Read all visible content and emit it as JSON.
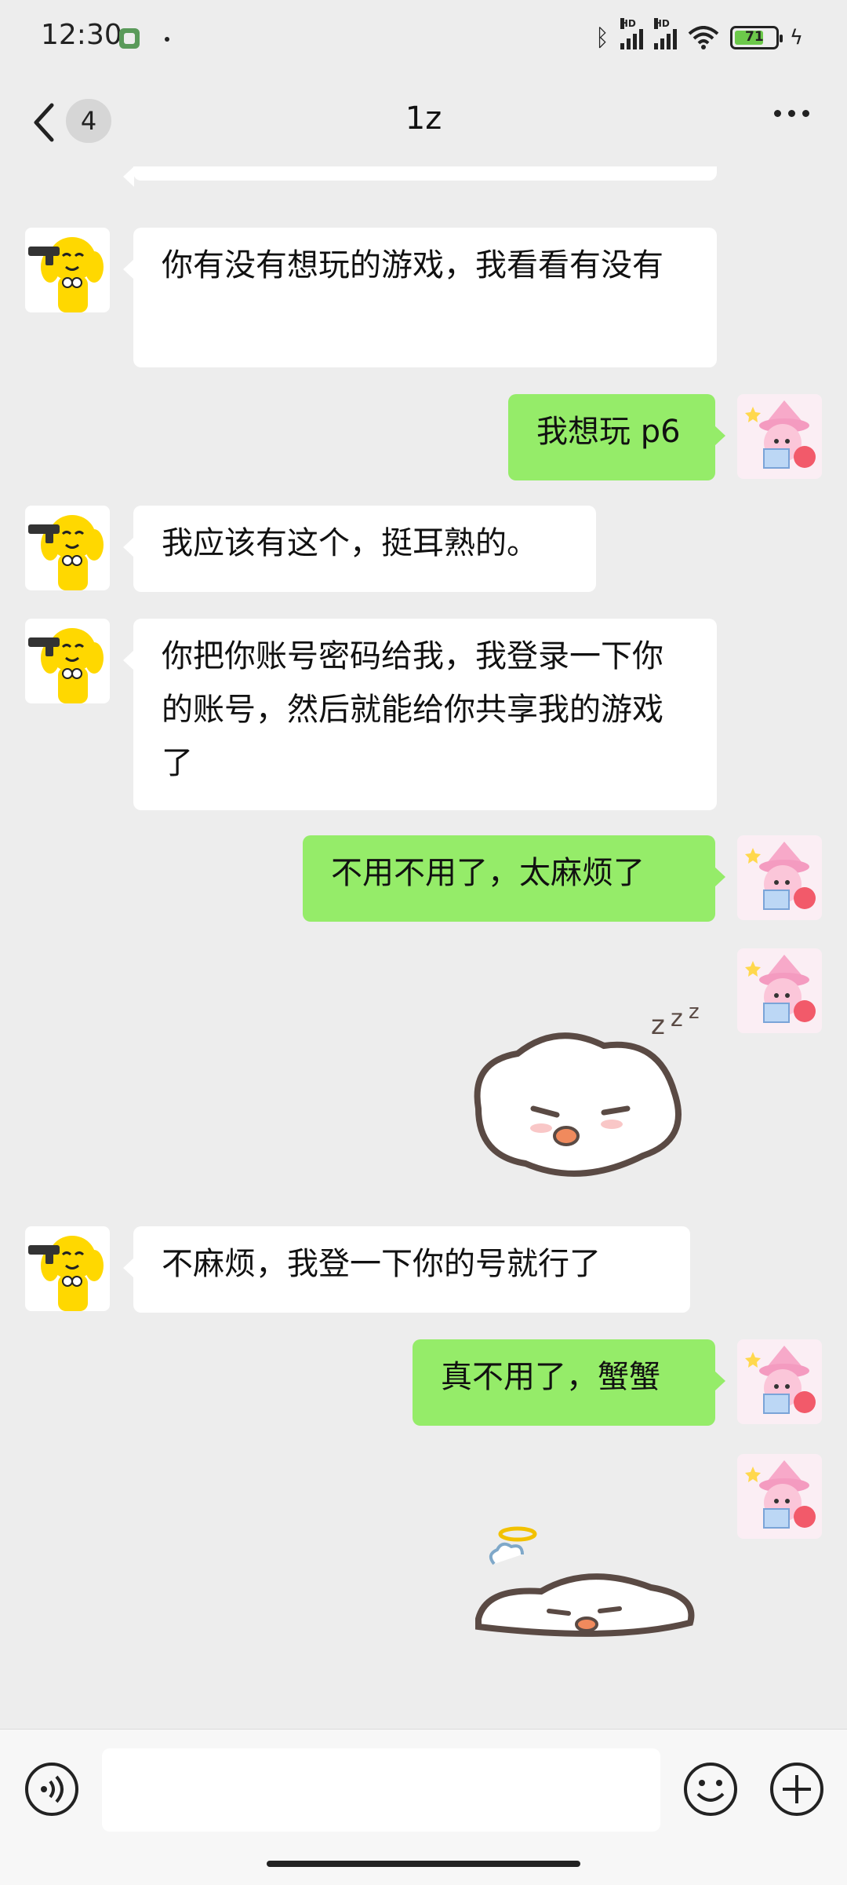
{
  "status": {
    "time": "12:30",
    "signal_label": "HD",
    "battery_level": "71"
  },
  "header": {
    "back_icon": "chevron-left-icon",
    "unread_count": "4",
    "title": "1z",
    "more_icon": "more-dots-icon"
  },
  "messages": [
    {
      "side": "left",
      "text": "你有没有想玩的游戏，我看看有没有"
    },
    {
      "side": "right",
      "text": "我想玩 p6"
    },
    {
      "side": "left",
      "text": "我应该有这个，挺耳熟的。"
    },
    {
      "side": "left",
      "text": "你把你账号密码给我，我登录一下你的账号，然后就能给你共享我的游戏了"
    },
    {
      "side": "right",
      "text": "不用不用了，太麻烦了"
    },
    {
      "side": "right",
      "sticker": "sleeping-blob-sticker"
    },
    {
      "side": "left",
      "text": "不麻烦，我登一下你的号就行了"
    },
    {
      "side": "right",
      "text": "真不用了，蟹蟹"
    },
    {
      "side": "right",
      "sticker": "melted-blob-sticker"
    }
  ],
  "input_bar": {
    "voice_icon": "voice-icon",
    "emoji_icon": "emoji-icon",
    "plus_icon": "plus-icon",
    "placeholder": ""
  },
  "colors": {
    "background": "#ededed",
    "sent_bubble": "#95ec69",
    "received_bubble": "#ffffff"
  }
}
